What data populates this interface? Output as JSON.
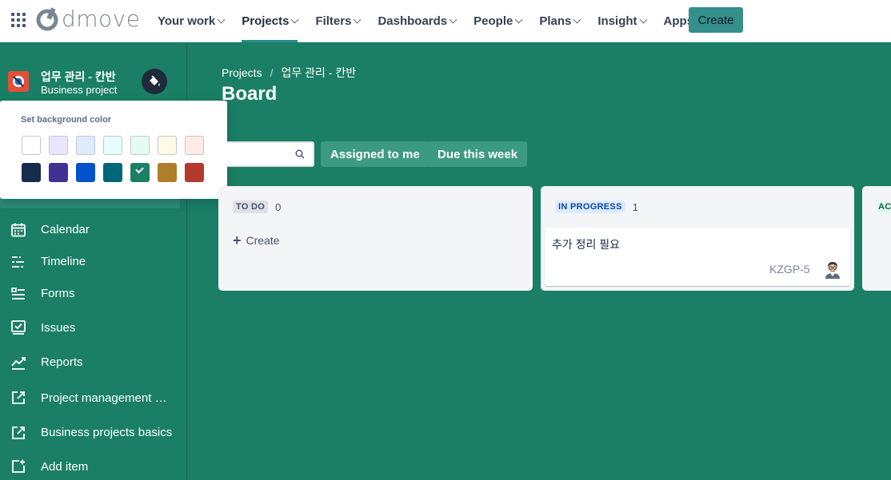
{
  "topnav": {
    "brand": "dmove",
    "items": [
      {
        "label": "Your work"
      },
      {
        "label": "Projects"
      },
      {
        "label": "Filters"
      },
      {
        "label": "Dashboards"
      },
      {
        "label": "People"
      },
      {
        "label": "Plans"
      },
      {
        "label": "Insight"
      },
      {
        "label": "Apps"
      }
    ],
    "active_item": "Projects",
    "create_label": "Create"
  },
  "project": {
    "name": "업무 관리 - 칸반",
    "type": "Business project"
  },
  "color_picker": {
    "title": "Set background color",
    "swatches_light": [
      "#ffffff",
      "#e9e5fe",
      "#deebff",
      "#e6fcff",
      "#e3fcef",
      "#fffae6",
      "#ffebe6"
    ],
    "swatches_dark": [
      "#172b4d",
      "#403294",
      "#0052cc",
      "#00667a",
      "#1a7f64",
      "#b07d2b",
      "#b33a2f"
    ],
    "selected": "#1a7f64"
  },
  "sidebar": {
    "items": [
      {
        "label": "Calendar",
        "icon": "calendar-icon"
      },
      {
        "label": "Timeline",
        "icon": "timeline-icon"
      },
      {
        "label": "Forms",
        "icon": "forms-icon"
      },
      {
        "label": "Issues",
        "icon": "issues-icon"
      },
      {
        "label": "Reports",
        "icon": "reports-icon"
      },
      {
        "label": "Project management wi...",
        "icon": "external-link-icon"
      },
      {
        "label": "Business projects basics",
        "icon": "external-link-icon"
      },
      {
        "label": "Add item",
        "icon": "add-item-icon"
      }
    ]
  },
  "main": {
    "breadcrumb": [
      "Projects",
      "업무 관리 - 칸반"
    ],
    "title": "Board",
    "filters": [
      "Assigned to me",
      "Due this week"
    ],
    "columns": [
      {
        "name": "TO DO",
        "count": "0",
        "create_label": "Create"
      },
      {
        "name": "IN PROGRESS",
        "count": "1",
        "card": {
          "title": "추가 정리 필요",
          "key": "KZGP-5"
        }
      },
      {
        "name": "AC"
      }
    ]
  },
  "colors": {
    "background": "#1a7f64",
    "accent": "#358f8c",
    "todo_lozenge": "#dfe1e6",
    "inprogress_lozenge": "#deebff",
    "done_lozenge": "#e3fcef"
  }
}
